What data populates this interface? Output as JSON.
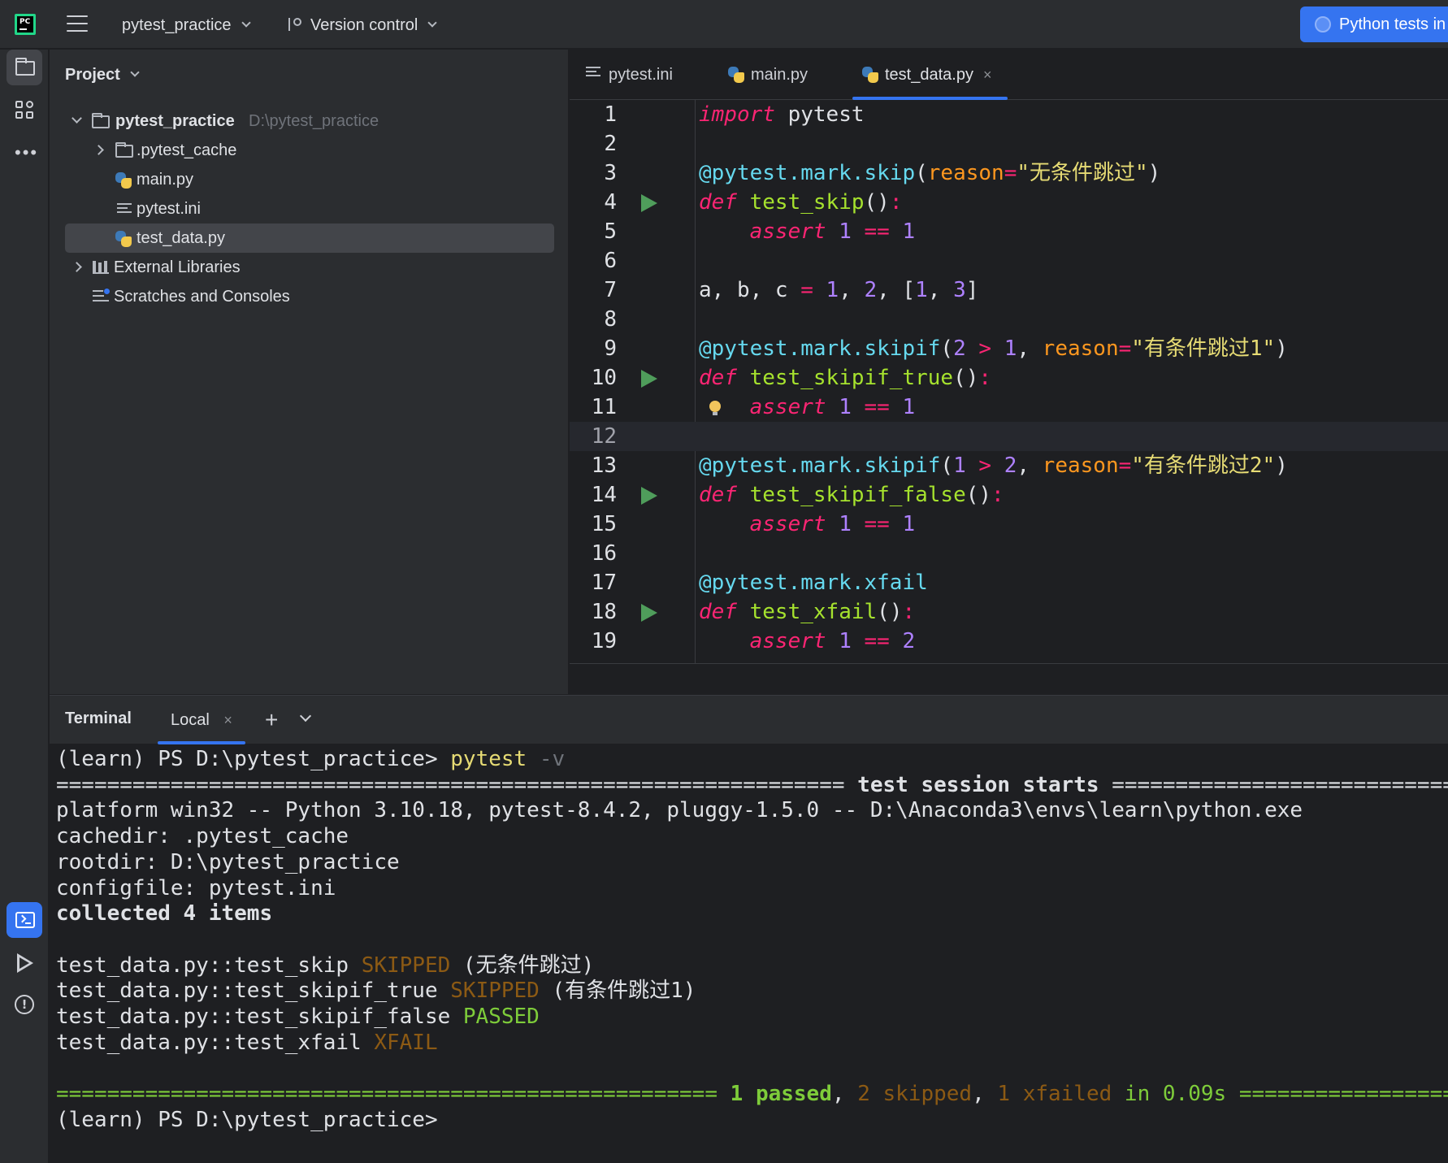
{
  "topbar": {
    "project_name": "pytest_practice",
    "vcs_label": "Version control",
    "run_config_label": "Python tests in"
  },
  "project_panel": {
    "title": "Project",
    "root": {
      "name": "pytest_practice",
      "path": "D:\\pytest_practice"
    },
    "items": [
      {
        "label": ".pytest_cache",
        "icon": "folder-icon"
      },
      {
        "label": "main.py",
        "icon": "python-file-icon"
      },
      {
        "label": "pytest.ini",
        "icon": "text-file-icon"
      },
      {
        "label": "test_data.py",
        "icon": "python-file-icon",
        "selected": true
      }
    ],
    "external_libraries": "External Libraries",
    "scratches": "Scratches and Consoles"
  },
  "editor": {
    "tabs": [
      {
        "label": "pytest.ini"
      },
      {
        "label": "main.py"
      },
      {
        "label": "test_data.py",
        "active": true,
        "close": "×"
      }
    ],
    "current_line": 12,
    "run_gutter_lines": [
      4,
      10,
      14,
      18
    ],
    "lines": [
      {
        "n": "1",
        "tokens": [
          {
            "t": "import",
            "c": "kw"
          },
          {
            "t": " pytest",
            "c": "pl"
          }
        ]
      },
      {
        "n": "2",
        "tokens": []
      },
      {
        "n": "3",
        "tokens": [
          {
            "t": "@pytest.mark.skip",
            "c": "dec"
          },
          {
            "t": "(",
            "c": "pl"
          },
          {
            "t": "reason",
            "c": "prm"
          },
          {
            "t": "=",
            "c": "op"
          },
          {
            "t": "\"无条件跳过\"",
            "c": "str"
          },
          {
            "t": ")",
            "c": "pl"
          }
        ]
      },
      {
        "n": "4",
        "tokens": [
          {
            "t": "def",
            "c": "kw"
          },
          {
            "t": " ",
            "c": "pl"
          },
          {
            "t": "test_skip",
            "c": "fn"
          },
          {
            "t": "()",
            "c": "pl"
          },
          {
            "t": ":",
            "c": "op"
          }
        ]
      },
      {
        "n": "5",
        "tokens": [
          {
            "t": "    ",
            "c": "pl"
          },
          {
            "t": "assert",
            "c": "kw"
          },
          {
            "t": " ",
            "c": "pl"
          },
          {
            "t": "1",
            "c": "num"
          },
          {
            "t": " == ",
            "c": "op"
          },
          {
            "t": "1",
            "c": "num"
          }
        ]
      },
      {
        "n": "6",
        "tokens": []
      },
      {
        "n": "7",
        "tokens": [
          {
            "t": "a, b, c ",
            "c": "pl"
          },
          {
            "t": "=",
            "c": "op"
          },
          {
            "t": " ",
            "c": "pl"
          },
          {
            "t": "1",
            "c": "num"
          },
          {
            "t": ", ",
            "c": "pl"
          },
          {
            "t": "2",
            "c": "num"
          },
          {
            "t": ", [",
            "c": "pl"
          },
          {
            "t": "1",
            "c": "num"
          },
          {
            "t": ", ",
            "c": "pl"
          },
          {
            "t": "3",
            "c": "num"
          },
          {
            "t": "]",
            "c": "pl"
          }
        ]
      },
      {
        "n": "8",
        "tokens": []
      },
      {
        "n": "9",
        "tokens": [
          {
            "t": "@pytest.mark.skipif",
            "c": "dec"
          },
          {
            "t": "(",
            "c": "pl"
          },
          {
            "t": "2",
            "c": "num"
          },
          {
            "t": " > ",
            "c": "op"
          },
          {
            "t": "1",
            "c": "num"
          },
          {
            "t": ", ",
            "c": "pl"
          },
          {
            "t": "reason",
            "c": "prm"
          },
          {
            "t": "=",
            "c": "op"
          },
          {
            "t": "\"有条件跳过1\"",
            "c": "str"
          },
          {
            "t": ")",
            "c": "pl"
          }
        ]
      },
      {
        "n": "10",
        "tokens": [
          {
            "t": "def",
            "c": "kw"
          },
          {
            "t": " ",
            "c": "pl"
          },
          {
            "t": "test_skipif_true",
            "c": "fn"
          },
          {
            "t": "()",
            "c": "pl"
          },
          {
            "t": ":",
            "c": "op"
          }
        ]
      },
      {
        "n": "11",
        "tokens": [
          {
            "t": "    ",
            "c": "pl"
          },
          {
            "t": "assert",
            "c": "kw"
          },
          {
            "t": " ",
            "c": "pl"
          },
          {
            "t": "1",
            "c": "num"
          },
          {
            "t": " == ",
            "c": "op"
          },
          {
            "t": "1",
            "c": "num"
          }
        ],
        "bulb": true
      },
      {
        "n": "12",
        "tokens": []
      },
      {
        "n": "13",
        "tokens": [
          {
            "t": "@pytest.mark.skipif",
            "c": "dec"
          },
          {
            "t": "(",
            "c": "pl"
          },
          {
            "t": "1",
            "c": "num"
          },
          {
            "t": " > ",
            "c": "op"
          },
          {
            "t": "2",
            "c": "num"
          },
          {
            "t": ", ",
            "c": "pl"
          },
          {
            "t": "reason",
            "c": "prm"
          },
          {
            "t": "=",
            "c": "op"
          },
          {
            "t": "\"有条件跳过2\"",
            "c": "str"
          },
          {
            "t": ")",
            "c": "pl"
          }
        ]
      },
      {
        "n": "14",
        "tokens": [
          {
            "t": "def",
            "c": "kw"
          },
          {
            "t": " ",
            "c": "pl"
          },
          {
            "t": "test_skipif_false",
            "c": "fn"
          },
          {
            "t": "()",
            "c": "pl"
          },
          {
            "t": ":",
            "c": "op"
          }
        ]
      },
      {
        "n": "15",
        "tokens": [
          {
            "t": "    ",
            "c": "pl"
          },
          {
            "t": "assert",
            "c": "kw"
          },
          {
            "t": " ",
            "c": "pl"
          },
          {
            "t": "1",
            "c": "num"
          },
          {
            "t": " == ",
            "c": "op"
          },
          {
            "t": "1",
            "c": "num"
          }
        ]
      },
      {
        "n": "16",
        "tokens": []
      },
      {
        "n": "17",
        "tokens": [
          {
            "t": "@pytest.mark.xfail",
            "c": "dec"
          }
        ]
      },
      {
        "n": "18",
        "tokens": [
          {
            "t": "def",
            "c": "kw"
          },
          {
            "t": " ",
            "c": "pl"
          },
          {
            "t": "test_xfail",
            "c": "fn"
          },
          {
            "t": "()",
            "c": "pl"
          },
          {
            "t": ":",
            "c": "op"
          }
        ]
      },
      {
        "n": "19",
        "tokens": [
          {
            "t": "    ",
            "c": "pl"
          },
          {
            "t": "assert",
            "c": "kw"
          },
          {
            "t": " ",
            "c": "pl"
          },
          {
            "t": "1",
            "c": "num"
          },
          {
            "t": " == ",
            "c": "op"
          },
          {
            "t": "2",
            "c": "num"
          }
        ]
      }
    ]
  },
  "terminal": {
    "title": "Terminal",
    "tab_label": "Local",
    "tab_close": "×",
    "add_label": "+",
    "lines": [
      [
        {
          "t": "(learn) PS D:\\pytest_practice> ",
          "c": ""
        },
        {
          "t": "pytest",
          "c": "t-yellow"
        },
        {
          "t": " -v",
          "c": "t-dim"
        }
      ],
      [
        {
          "t": "============================================================== ",
          "c": ""
        },
        {
          "t": "test session starts",
          "c": "t-bold"
        },
        {
          "t": " ==============================",
          "c": ""
        }
      ],
      [
        {
          "t": "platform win32 -- Python 3.10.18, pytest-8.4.2, pluggy-1.5.0 -- D:\\Anaconda3\\envs\\learn\\python.exe",
          "c": ""
        }
      ],
      [
        {
          "t": "cachedir: .pytest_cache",
          "c": ""
        }
      ],
      [
        {
          "t": "rootdir: D:\\pytest_practice",
          "c": ""
        }
      ],
      [
        {
          "t": "configfile: pytest.ini",
          "c": ""
        }
      ],
      [
        {
          "t": "collected 4 items",
          "c": "t-bold"
        }
      ],
      [],
      [
        {
          "t": "test_data.py::test_skip ",
          "c": ""
        },
        {
          "t": "SKIPPED",
          "c": "t-orange"
        },
        {
          "t": " (无条件跳过)",
          "c": ""
        }
      ],
      [
        {
          "t": "test_data.py::test_skipif_true ",
          "c": ""
        },
        {
          "t": "SKIPPED",
          "c": "t-orange"
        },
        {
          "t": " (有条件跳过1)",
          "c": ""
        }
      ],
      [
        {
          "t": "test_data.py::test_skipif_false ",
          "c": ""
        },
        {
          "t": "PASSED",
          "c": "t-green"
        }
      ],
      [
        {
          "t": "test_data.py::test_xfail ",
          "c": ""
        },
        {
          "t": "XFAIL",
          "c": "t-orange"
        }
      ],
      [],
      [
        {
          "t": "==================================================== ",
          "c": "t-green"
        },
        {
          "t": "1 passed",
          "c": "t-greenb"
        },
        {
          "t": ", ",
          "c": ""
        },
        {
          "t": "2 skipped",
          "c": "t-orange"
        },
        {
          "t": ", ",
          "c": ""
        },
        {
          "t": "1 xfailed",
          "c": "t-orange"
        },
        {
          "t": " in 0.09s",
          "c": "t-green"
        },
        {
          "t": " ===================",
          "c": "t-green"
        }
      ],
      [
        {
          "t": "(learn) PS D:\\pytest_practice>",
          "c": ""
        }
      ]
    ]
  },
  "colors": {
    "accent": "#3574f0",
    "run_green": "#4f9d5b",
    "keyword": "#fa2573",
    "decorator": "#66d9ef",
    "function": "#a6e22e",
    "number": "#ae81ff",
    "string": "#e6db74"
  }
}
